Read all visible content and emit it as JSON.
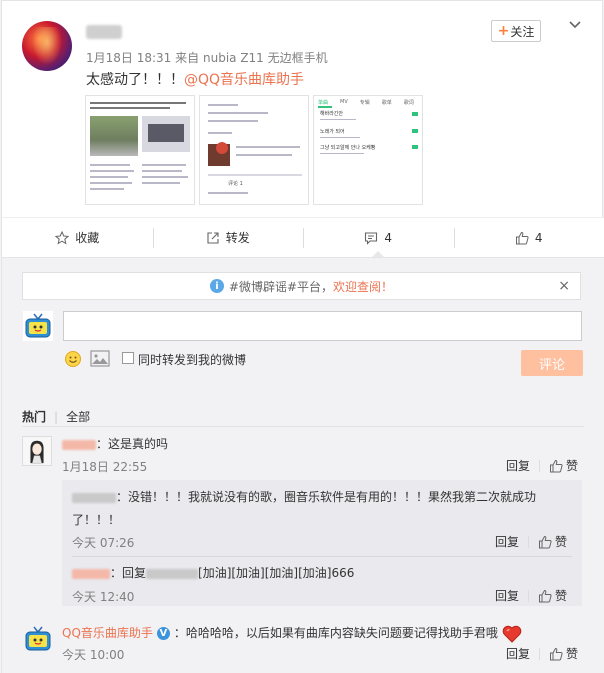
{
  "post": {
    "time": "1月18日 18:31",
    "source_prefix": "来自",
    "source": "nubia Z11 无边框手机",
    "text": "太感动了！！！",
    "mention": "@QQ音乐曲库助手",
    "follow_label": "关注",
    "follow_plus": "+"
  },
  "thumbs": {
    "t3_tabs": [
      "单曲",
      "MV",
      "专辑",
      "歌单",
      "歌词"
    ],
    "t3_rows": [
      "해바라긴안",
      "노래가 되어",
      "그냥 되고알께 안나 오케빵"
    ],
    "t2_label": "评论 1"
  },
  "actions": {
    "favorite": "收藏",
    "forward": "转发",
    "comment_count": "4",
    "like_count": "4"
  },
  "notice": {
    "info": "i",
    "text": "#微博辟谣#平台，",
    "highlight": "欢迎查阅！",
    "close": "×"
  },
  "composer": {
    "input_value": "",
    "forward_label": "同时转发到我的微博",
    "submit_label": "评论"
  },
  "tabs": {
    "hot": "热门",
    "all": "全部"
  },
  "comments": [
    {
      "text": "：这是真的吗",
      "time": "1月18日 22:55",
      "reply_label": "回复",
      "like_label": "赞"
    },
    {
      "text": "QQ音乐曲库助手",
      "verified": "V",
      "body": "：哈哈哈哈，以后如果有曲库内容缺失问题要记得找助手君哦",
      "time": "今天 10:00",
      "reply_label": "回复",
      "like_label": "赞"
    }
  ],
  "replies": [
    {
      "text_line1": "：没错！！！我就说没有的歌，圈音乐软件是有用的！！！果然我第二次就成功",
      "text_line2": "了！！！",
      "time": "今天 07:26",
      "reply_label": "回复",
      "like_label": "赞"
    },
    {
      "prefix": "：回复",
      "text": "[加油][加油][加油][加油]666",
      "time": "今天 12:40",
      "reply_label": "回复",
      "like_label": "赞"
    }
  ]
}
